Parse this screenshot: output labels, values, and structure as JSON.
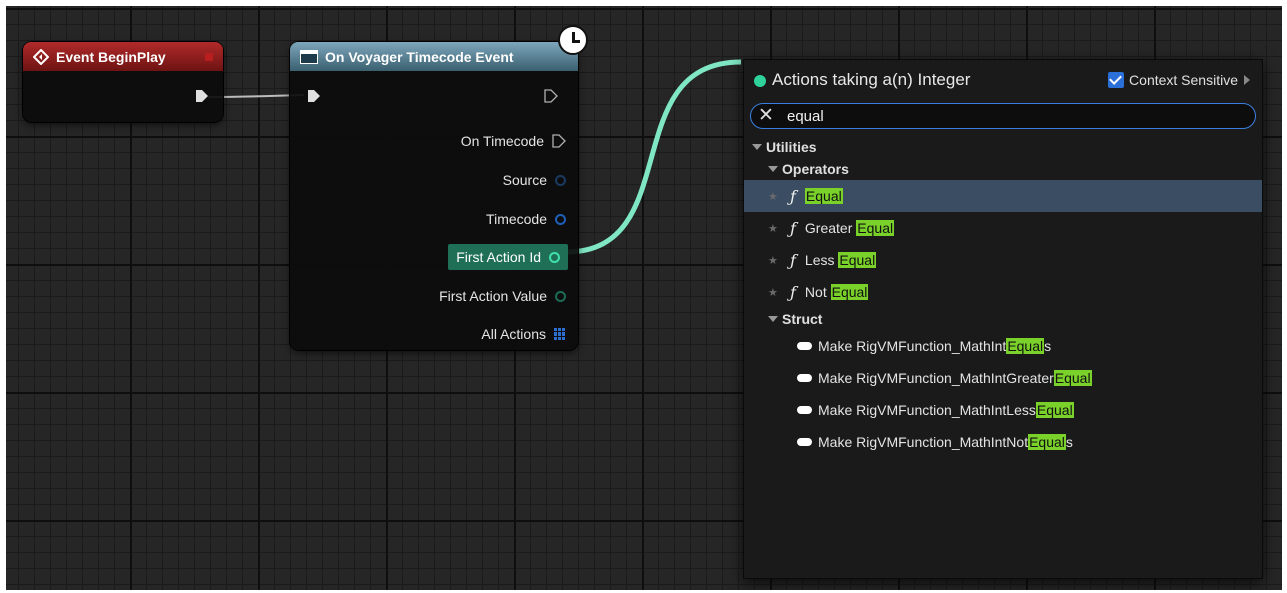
{
  "nodes": {
    "begin_play": {
      "title": "Event BeginPlay"
    },
    "voyager": {
      "title": "On Voyager Timecode Event",
      "pins": [
        {
          "label": "On Timecode",
          "kind": "exec"
        },
        {
          "label": "Source",
          "kind": "object",
          "color": "#1a3a60"
        },
        {
          "label": "Timecode",
          "kind": "struct",
          "color": "#1e5fb8"
        },
        {
          "label": "First Action Id",
          "kind": "integer",
          "color": "#3fe0ab",
          "connected": true
        },
        {
          "label": "First Action Value",
          "kind": "object",
          "color": "#1d6b55"
        },
        {
          "label": "All Actions",
          "kind": "array",
          "color": "#2c6fd0"
        }
      ]
    }
  },
  "menu": {
    "title": "Actions taking a(n) Integer",
    "context_label": "Context Sensitive",
    "context_checked": true,
    "search": {
      "value": "equal",
      "clear_symbol": "✕"
    },
    "categories": {
      "utilities": "Utilities",
      "operators": "Operators",
      "struct": "Struct"
    },
    "function_symbol": "ƒ",
    "operators": [
      {
        "pre": "",
        "match": "Equal",
        "post": "",
        "selected": true
      },
      {
        "pre": "Greater ",
        "match": "Equal",
        "post": ""
      },
      {
        "pre": "Less ",
        "match": "Equal",
        "post": ""
      },
      {
        "pre": "Not ",
        "match": "Equal",
        "post": ""
      }
    ],
    "struct_items": [
      {
        "pre": "Make RigVMFunction_MathInt",
        "match": "Equal",
        "post": "s"
      },
      {
        "pre": "Make RigVMFunction_MathIntGreater",
        "match": "Equal",
        "post": ""
      },
      {
        "pre": "Make RigVMFunction_MathIntLess",
        "match": "Equal",
        "post": ""
      },
      {
        "pre": "Make RigVMFunction_MathIntNot",
        "match": "Equal",
        "post": "s"
      }
    ]
  },
  "colors": {
    "integer_wire": "#7fe7c4",
    "exec_wire": "#bdbdbd",
    "highlight": "#79d12a",
    "selection": "#3b4d63",
    "search_border": "#3a7fe0"
  }
}
